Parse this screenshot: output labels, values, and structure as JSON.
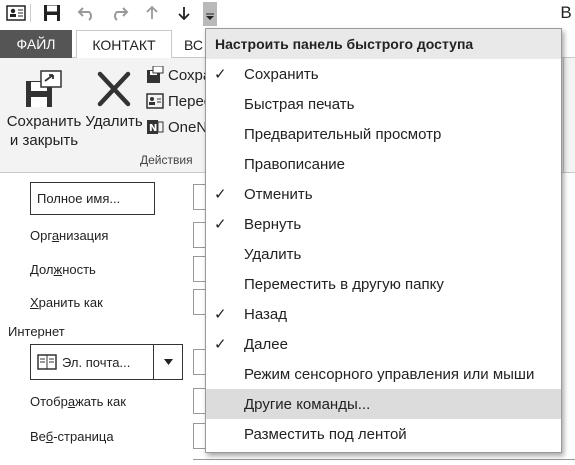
{
  "qat": {
    "icons": [
      "contact-card-icon",
      "save-icon",
      "undo-icon",
      "redo-icon",
      "up-arrow-icon",
      "down-arrow-icon",
      "customize-dropdown-icon"
    ],
    "right_glyph": "В"
  },
  "tabs": {
    "file": "ФАЙЛ",
    "contact": "КОНТАКТ",
    "partial": "ВС"
  },
  "ribbon": {
    "save_close_line1": "Сохранить",
    "save_close_line2": "и закрыть",
    "delete": "Удалить",
    "small": [
      "Сохранить",
      "Переслать",
      "OneNote"
    ],
    "group_label": "Действия"
  },
  "form": {
    "full_name_button": "Полное имя...",
    "labels": {
      "organization": {
        "pre": "Орг",
        "ul": "а",
        "post": "низация"
      },
      "job_title": {
        "pre": "Дол",
        "ul": "ж",
        "post": "ность"
      },
      "file_as": {
        "pre": "",
        "ul": "Х",
        "post": "ранить как"
      },
      "display_as": {
        "pre": "Отобр",
        "ul": "а",
        "post": "жать как"
      },
      "web_page": {
        "pre": "Ве",
        "ul": "б",
        "post": "-страница"
      }
    },
    "internet_section": "Интернет",
    "email_button": "Эл. почта..."
  },
  "menu": {
    "header": "Настроить панель быстрого доступа",
    "items": [
      {
        "label": "Сохранить",
        "checked": true
      },
      {
        "label": "Быстрая печать",
        "checked": false
      },
      {
        "label": "Предварительный просмотр",
        "checked": false
      },
      {
        "label": "Правописание",
        "checked": false
      },
      {
        "label": "Отменить",
        "checked": true
      },
      {
        "label": "Вернуть",
        "checked": true
      },
      {
        "label": "Удалить",
        "checked": false
      },
      {
        "label": "Переместить в другую папку",
        "checked": false
      },
      {
        "label": "Назад",
        "checked": true
      },
      {
        "label": "Далее",
        "checked": true
      },
      {
        "label": "Режим сенсорного управления или мыши",
        "checked": false
      },
      {
        "label": "Другие команды...",
        "checked": false,
        "highlighted": true
      },
      {
        "label": "Разместить под лентой",
        "checked": false
      }
    ],
    "check_glyph": "✓"
  }
}
